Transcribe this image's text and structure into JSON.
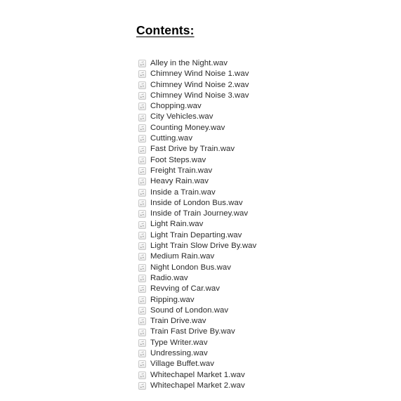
{
  "document": {
    "heading": "Contents:",
    "background_color": "#ffffff",
    "text_color": "#2b2b2b",
    "heading_color": "#000000"
  },
  "file_list": {
    "icon_name": "audio-file-icon",
    "icon_glyph": "music-note",
    "icon_fill": "#8c8c8c",
    "icon_background": "#f2f2f2",
    "icon_border": "#c9c9c9",
    "count": 31,
    "items": [
      {
        "label": "Alley in the Night.wav"
      },
      {
        "label": "Chimney Wind Noise 1.wav"
      },
      {
        "label": "Chimney Wind Noise 2.wav"
      },
      {
        "label": "Chimney Wind Noise 3.wav"
      },
      {
        "label": "Chopping.wav"
      },
      {
        "label": "City Vehicles.wav"
      },
      {
        "label": "Counting Money.wav"
      },
      {
        "label": "Cutting.wav"
      },
      {
        "label": "Fast Drive by Train.wav"
      },
      {
        "label": "Foot Steps.wav"
      },
      {
        "label": "Freight Train.wav"
      },
      {
        "label": "Heavy Rain.wav"
      },
      {
        "label": "Inside a Train.wav"
      },
      {
        "label": "Inside of London Bus.wav"
      },
      {
        "label": "Inside of Train Journey.wav"
      },
      {
        "label": "Light Rain.wav"
      },
      {
        "label": "Light Train Departing.wav"
      },
      {
        "label": "Light Train Slow Drive By.wav"
      },
      {
        "label": "Medium Rain.wav"
      },
      {
        "label": "Night London Bus.wav"
      },
      {
        "label": "Radio.wav"
      },
      {
        "label": "Revving of Car.wav"
      },
      {
        "label": "Ripping.wav"
      },
      {
        "label": "Sound of London.wav"
      },
      {
        "label": "Train Drive.wav"
      },
      {
        "label": "Train Fast Drive By.wav"
      },
      {
        "label": "Type Writer.wav"
      },
      {
        "label": "Undressing.wav"
      },
      {
        "label": "Village Buffet.wav"
      },
      {
        "label": "Whitechapel Market 1.wav"
      },
      {
        "label": "Whitechapel Market 2.wav"
      }
    ]
  }
}
